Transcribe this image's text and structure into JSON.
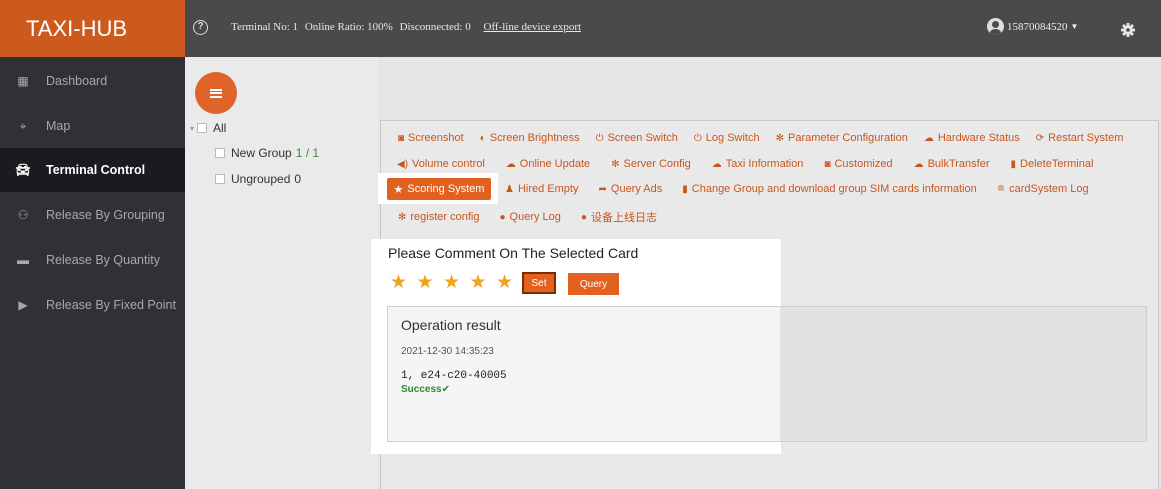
{
  "app": {
    "brand": "TAXI-HUB"
  },
  "header": {
    "terminal_no": "Terminal No: 1",
    "online_ratio": "Online Ratio: 100%",
    "disconnected": "Disconnected: 0",
    "export_link": "Off-line device export",
    "username": "15870084520"
  },
  "sidebar": {
    "items": [
      {
        "label": "Dashboard",
        "icon": "dashboard-icon"
      },
      {
        "label": "Map",
        "icon": "map-icon"
      },
      {
        "label": "Terminal Control",
        "icon": "car-icon",
        "active": true
      },
      {
        "label": "Release By Grouping",
        "icon": "group-icon"
      },
      {
        "label": "Release By Quantity",
        "icon": "quantity-icon"
      },
      {
        "label": "Release By Fixed Point",
        "icon": "play-icon"
      }
    ]
  },
  "tree": {
    "root": "All",
    "groups": [
      {
        "name": "New Group",
        "count": "1 / 1"
      },
      {
        "name": "Ungrouped",
        "count": "0"
      }
    ]
  },
  "toolbar": {
    "row1": [
      "Screenshot",
      "Screen Brightness",
      "Screen Switch",
      "Log Switch",
      "Parameter Configuration",
      "Hardware Status",
      "Restart System"
    ],
    "row2": [
      "Volume control",
      "Online Update",
      "Server Config",
      "Taxi Information",
      "Customized",
      "BulkTransfer",
      "DeleteTerminal"
    ],
    "row3": [
      "Scoring System",
      "Hired Empty",
      "Query Ads",
      "Change Group and download group SIM cards information",
      "cardSystem Log"
    ],
    "row4": [
      "register config",
      "Query Log",
      "设备上线日志"
    ]
  },
  "dialog": {
    "title": "Please Comment On The Selected Card",
    "rating": 5,
    "max_rating": 5,
    "set_label": "Set",
    "query_label": "Query",
    "result_title": "Operation result",
    "result_time": "2021-12-30 14:35:23",
    "result_line": "1, e24-c20-40005",
    "result_status": "Success✔"
  },
  "colors": {
    "accent": "#e3611f",
    "brand_bg": "#cc5a1f",
    "star": "#f4a21a",
    "success": "#2d8a2d"
  }
}
